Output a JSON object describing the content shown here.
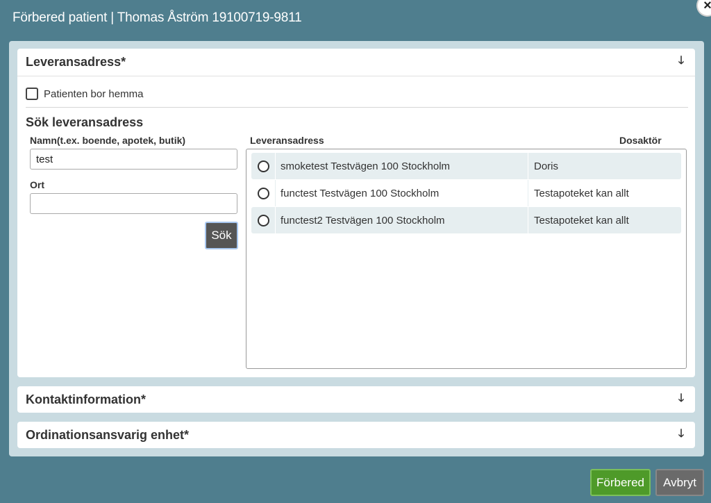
{
  "dialog": {
    "title": "Förbered patient | Thomas Åström 19100719-9811",
    "close_symbol": "×"
  },
  "delivery": {
    "header": "Leveransadress*",
    "checkbox_label": "Patienten bor hemma",
    "checkbox_checked": false,
    "search_title": "Sök leveransadress",
    "name_label": "Namn(t.ex. boende, apotek, butik)",
    "name_value": "test",
    "city_label": "Ort",
    "city_value": "",
    "search_button": "Sök",
    "col_address": "Leveransadress",
    "col_actor": "Dosaktör",
    "results": [
      {
        "address": "smoketest Testvägen 100 Stockholm",
        "actor": "Doris"
      },
      {
        "address": "functest Testvägen 100 Stockholm",
        "actor": "Testapoteket kan allt"
      },
      {
        "address": "functest2 Testvägen 100 Stockholm",
        "actor": "Testapoteket kan allt"
      }
    ]
  },
  "contact": {
    "header": "Kontaktinformation*"
  },
  "ordination": {
    "header": "Ordinationsansvarig enhet*"
  },
  "footer": {
    "prepare": "Förbered",
    "cancel": "Avbryt"
  },
  "icons": {
    "arrow": "arrow-down-icon",
    "close": "close-icon"
  },
  "colors": {
    "background": "#4f7e8e",
    "primary_button": "#4e9a29",
    "secondary_button": "#6a6a6a"
  }
}
